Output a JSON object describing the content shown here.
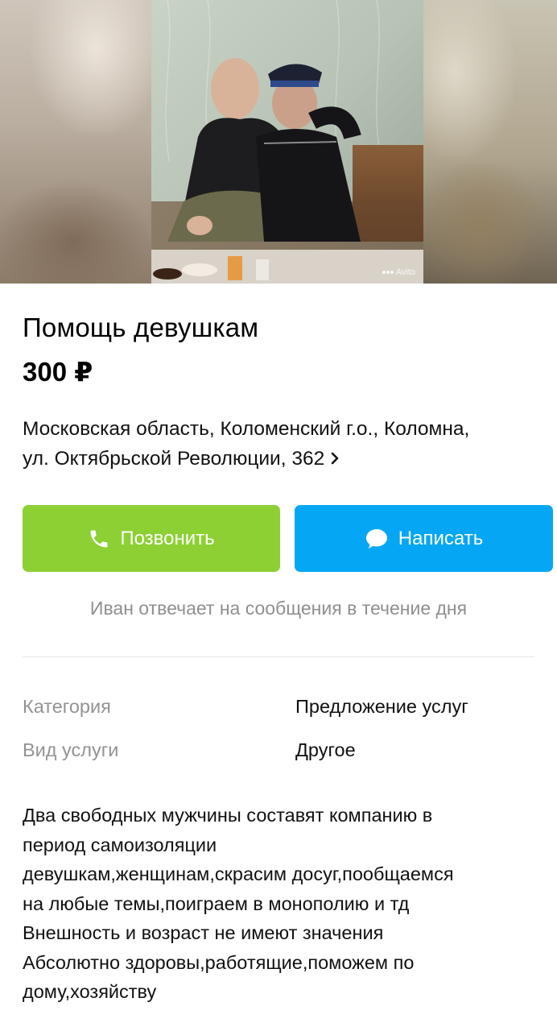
{
  "listing": {
    "photo_watermark": "Avito",
    "title": "Помощь девушкам",
    "price": "300 ₽",
    "address_line1": "Московская область, Коломенский г.о., Коломна,",
    "address_line2": "ул. Октябрьской Революции, 362",
    "address_chevron": "›"
  },
  "actions": {
    "call_label": "Позвонить",
    "write_label": "Написать",
    "call_color": "#8cd033",
    "write_color": "#05a7f5",
    "call_icon": "phone-icon",
    "write_icon": "chat-bubble-icon"
  },
  "seller_note": "Иван отвечает на сообщения в течение дня",
  "params": [
    {
      "label": "Категория",
      "value": "Предложение услуг"
    },
    {
      "label": "Вид услуги",
      "value": "Другое"
    }
  ],
  "description_lines": [
    "Два свободных мужчины составят компанию в",
    "период самоизоляции",
    "девушкам,женщинам,скрасим досуг,пообщаемся",
    "на любые темы,поиграем в монополию и тд",
    "Внешность и возраст не имеют значения",
    "Абсолютно здоровы,работящие,поможем по",
    "дому,хозяйству"
  ]
}
